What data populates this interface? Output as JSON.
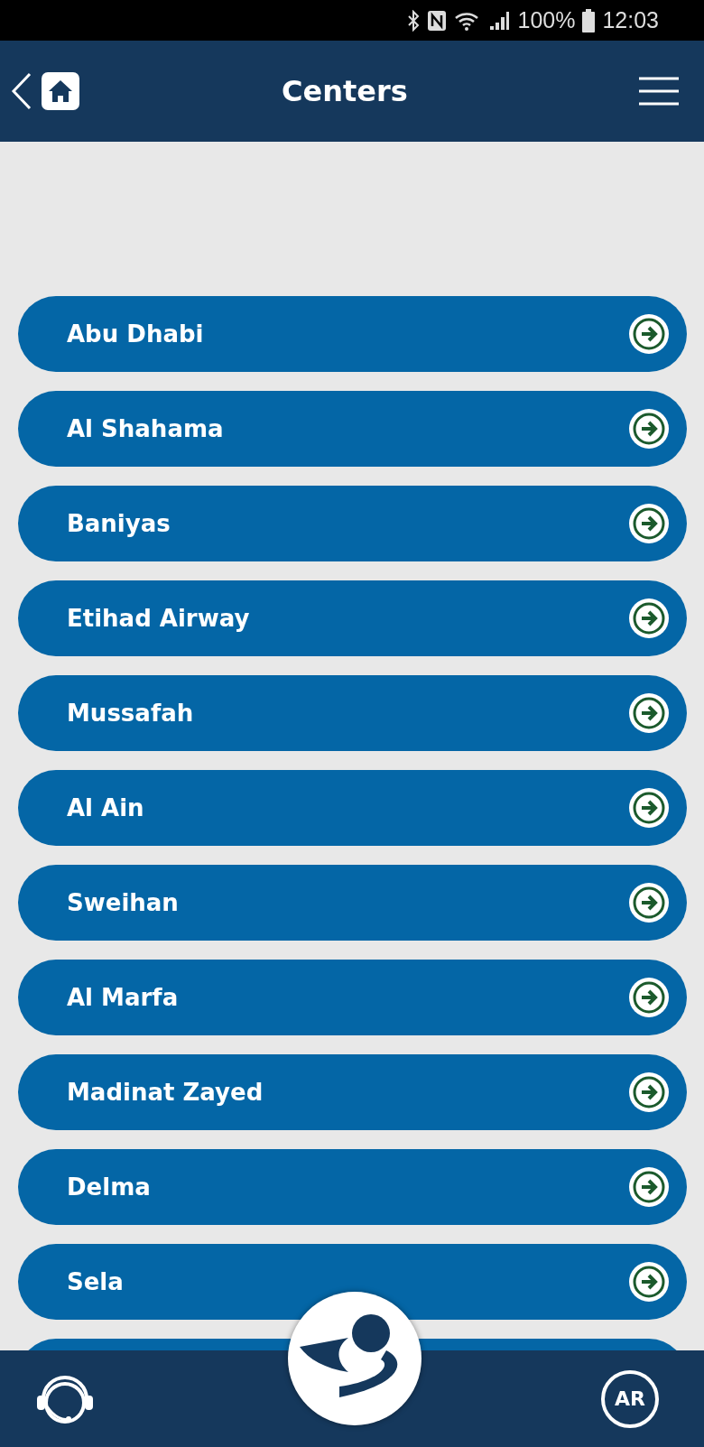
{
  "status_bar": {
    "battery": "100%",
    "time": "12:03"
  },
  "header": {
    "title": "Centers"
  },
  "centers": [
    {
      "name": "Abu Dhabi"
    },
    {
      "name": "Al Shahama"
    },
    {
      "name": "Baniyas"
    },
    {
      "name": "Etihad Airway"
    },
    {
      "name": "Mussafah"
    },
    {
      "name": "Al Ain"
    },
    {
      "name": "Sweihan"
    },
    {
      "name": "Al Marfa"
    },
    {
      "name": "Madinat Zayed"
    },
    {
      "name": "Delma"
    },
    {
      "name": "Sela"
    }
  ],
  "bottom_bar": {
    "language_button": "AR"
  }
}
